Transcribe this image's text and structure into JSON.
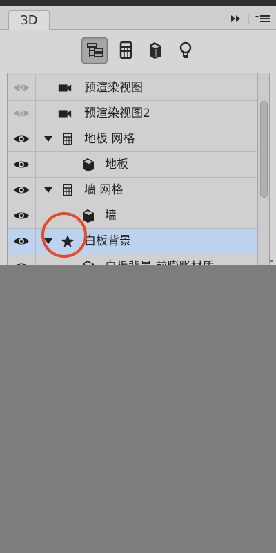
{
  "panel": {
    "tab_label": "3D",
    "header_icons": {
      "collapse": "double-chevron-right-icon",
      "menu": "panel-menu-icon"
    },
    "filters": [
      {
        "name": "scene",
        "icon": "scene-hierarchy-icon",
        "active": true
      },
      {
        "name": "meshes",
        "icon": "mesh-icon",
        "active": false
      },
      {
        "name": "materials",
        "icon": "material-icon",
        "active": false
      },
      {
        "name": "lights",
        "icon": "lightbulb-icon",
        "active": false
      }
    ]
  },
  "layers": [
    {
      "label": "预渲染视图",
      "icon": "camera-icon",
      "visible": false
    },
    {
      "label": "预渲染视图2",
      "icon": "camera-icon",
      "visible": false
    },
    {
      "label": "地板 网格",
      "icon": "mesh-icon",
      "visible": true,
      "expanded": true
    },
    {
      "label": "地板",
      "icon": "material-icon",
      "visible": true
    },
    {
      "label": "墙 网格",
      "icon": "mesh-icon",
      "visible": true,
      "expanded": true
    },
    {
      "label": "墙",
      "icon": "material-icon",
      "visible": true
    },
    {
      "label": "白板背景",
      "icon": "mesh-star-icon",
      "visible": true,
      "expanded": true,
      "selected": true
    },
    {
      "label": "白板背景 前膨胀材质",
      "icon": "material-icon",
      "visible": true
    }
  ],
  "annotation": {
    "circle_color": "#e34b2d"
  }
}
